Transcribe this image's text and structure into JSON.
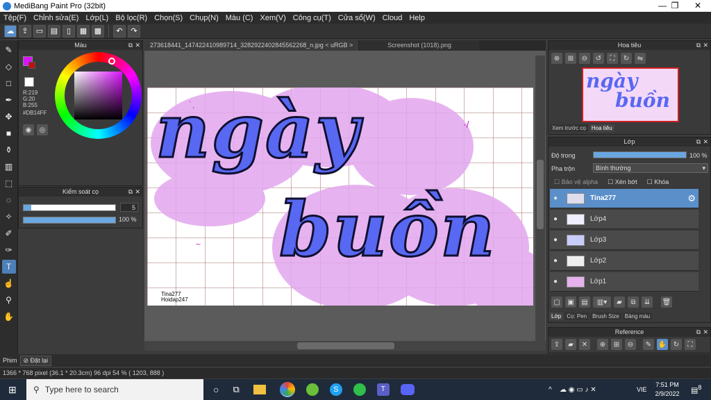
{
  "window": {
    "title": "MediBang Paint Pro (32bit)",
    "min": "—",
    "max": "❐",
    "close": "✕"
  },
  "menu": [
    "Tệp(F)",
    "Chỉnh sửa(E)",
    "Lớp(L)",
    "Bộ lọc(R)",
    "Chọn(S)",
    "Chụp(N)",
    "Màu (C)",
    "Xem(V)",
    "Công cụ(T)",
    "Cửa sổ(W)",
    "Cloud",
    "Help"
  ],
  "color_panel": {
    "title": "Màu",
    "r": "R:219",
    "g": "G:20",
    "b": "B:255",
    "hex": "#DB14FF",
    "fg": "#DB14FF",
    "bg": "#ffffff"
  },
  "brush_panel": {
    "title": "Kiểm soát cọ",
    "size": "5",
    "opacity": "100 %",
    "opacity_pct": 100,
    "size_fill_pct": 8
  },
  "tabs": {
    "file": "273618441_147422410989714_3282922402845562268_n.jpg < uRGB >",
    "shot": "Screenshot (1018).png"
  },
  "artwork": {
    "line1": "ngày",
    "line2": "buồn",
    "credit1": "Tina277",
    "credit2": "Hoidap247"
  },
  "navigator": {
    "title": "Hoa tiêu",
    "tab_preview": "Xem trước cọ",
    "tab_nav": "Hoa tiêu"
  },
  "layer_panel": {
    "title": "Lớp",
    "opacity_label": "Độ trong",
    "opacity_value": "100 %",
    "opacity_pct": 100,
    "blend_label": "Pha trộn",
    "blend_value": "Bình thường",
    "protect_alpha": "Bảo vệ alpha",
    "clip": "Xén bớt",
    "lock": "Khóa",
    "layers": [
      "Tina277",
      "Lớp4",
      "Lớp3",
      "Lớp2",
      "Lớp1"
    ],
    "tabs": [
      "Lớp",
      "Cọ: Pen",
      "Brush Size",
      "Bảng màu"
    ]
  },
  "reference": {
    "title": "Reference"
  },
  "bottom": {
    "phim": "Phim",
    "reset": "Đặt lại"
  },
  "status": {
    "dims": "1366 * 768 pixel",
    "cm": "(36.1 * 20.3cm)",
    "dpi": "96 dpi",
    "zoom": "54 %",
    "coords": "( 1203, 888 )"
  },
  "taskbar": {
    "search_placeholder": "Type here to search",
    "time": "7:51 PM",
    "date": "2/9/2022",
    "lang": "VIE",
    "notif": "8"
  }
}
